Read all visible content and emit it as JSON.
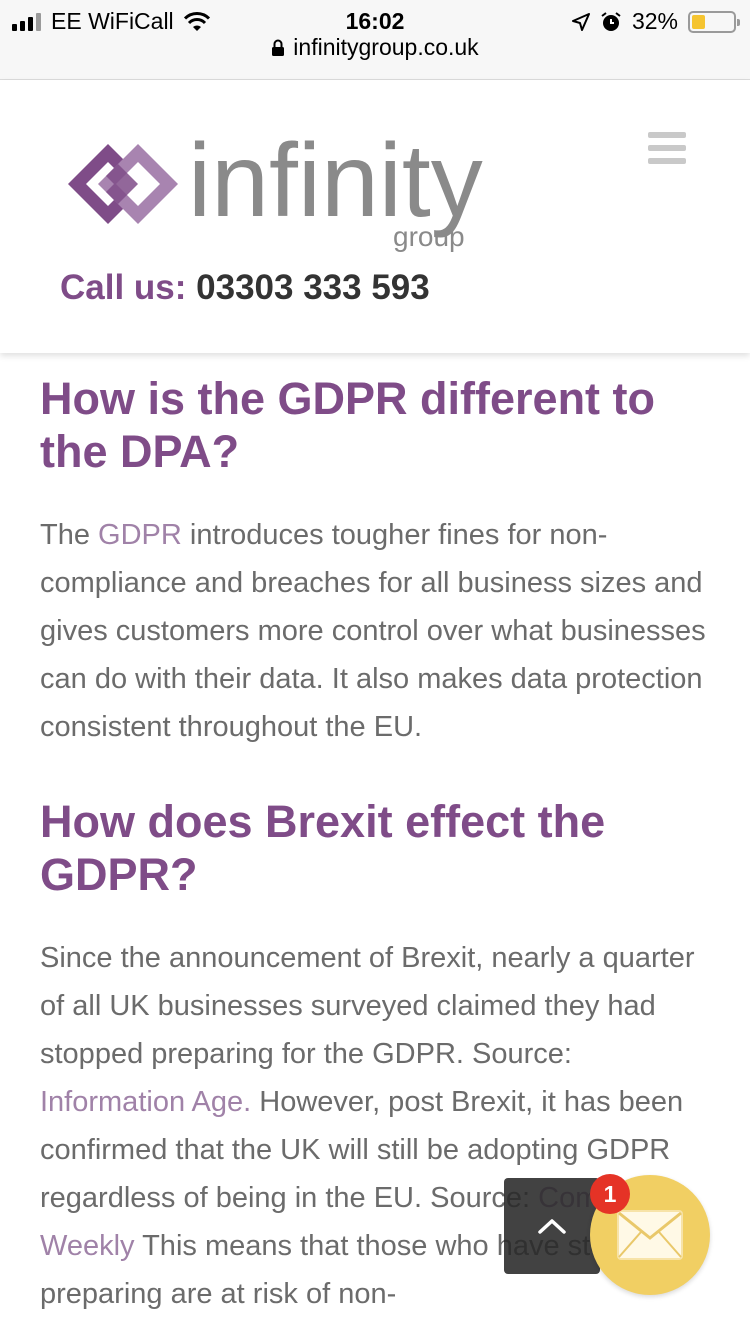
{
  "status_bar": {
    "carrier": "EE WiFiCall",
    "time": "16:02",
    "battery": "32%",
    "battery_level": 0.32,
    "url": "infinitygroup.co.uk"
  },
  "header": {
    "logo_text": "infinity",
    "logo_subtext": "group",
    "call_label": "Call us:",
    "phone": "03303 333 593",
    "brand_color": "#7f4c88"
  },
  "article": {
    "h1": "How is the GDPR different to the DPA?",
    "p1": {
      "pre": "The ",
      "link": "GDPR",
      "post": " introduces tougher fines for non-compliance and breaches for all business sizes and gives customers more control over what businesses can do with their data. It also makes data protection consistent throughout the EU."
    },
    "h2": "How does Brexit effect the GDPR?",
    "p2": {
      "t1": "Since the announcement of Brexit, nearly a quarter of all UK businesses surveyed claimed they had stopped preparing for the GDPR. Source: ",
      "link1": "Information Age.",
      "t2": " However, post Brexit, it has been confirmed that the UK will still be adopting GDPR regardless of being in the EU. Source: ",
      "link2": "Computer Weekly",
      "t3": " This means that those who have stopped preparing are at risk of non-"
    }
  },
  "widgets": {
    "back_to_top_icon": "chevron-up-icon",
    "mail_icon": "envelope-icon",
    "badge_count": "1"
  }
}
